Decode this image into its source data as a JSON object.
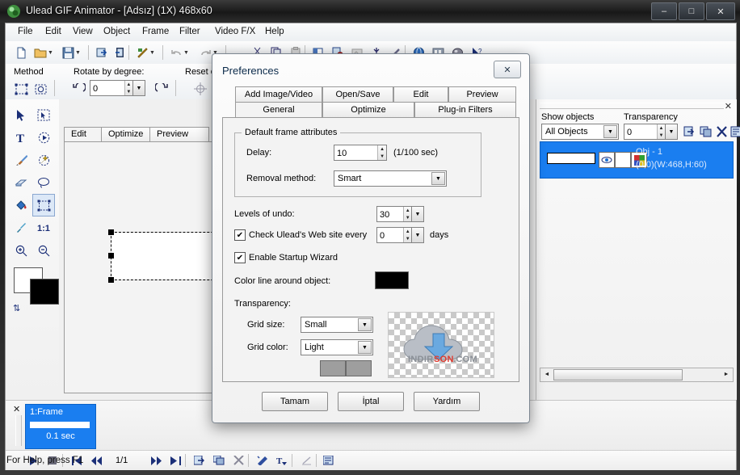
{
  "window": {
    "title": "Ulead GIF Animator - [Adsız] (1X) 468x60",
    "minimize": "–",
    "maximize": "□",
    "close": "✕",
    "app_icon": "app-icon"
  },
  "menubar": {
    "items": [
      "File",
      "Edit",
      "View",
      "Object",
      "Frame",
      "Filter",
      "Video F/X",
      "Help"
    ]
  },
  "toolbar_main": {
    "icons": [
      "new-file-icon",
      "open-folder-icon",
      "open-dropdown-caret",
      "save-icon",
      "save-dropdown-caret",
      "add-image-icon",
      "add-video-icon",
      "effects-icon",
      "effects-dropdown-caret",
      "undo-icon",
      "undo-dropdown-caret",
      "redo-icon",
      "redo-dropdown-caret",
      "cut-icon",
      "copy-icon",
      "paste-icon",
      "align-icon",
      "duplicate-icon",
      "optimize-icon",
      "wand-icon",
      "paint-icon",
      "browser-preview-icon",
      "filmstrip-icon",
      "object-icon",
      "help-arrow-icon"
    ]
  },
  "toolbar_attr": {
    "method_label": "Method",
    "method_icons": [
      "transform-method-icon",
      "rotate-method-icon"
    ],
    "rotate_label": "Rotate by degree:",
    "rotate_value": "0",
    "rotate_ccw_icon": "rotate-ccw-icon",
    "rotate_cw_icon": "rotate-cw-icon",
    "reset_label": "Reset c",
    "reset_icon": "reset-center-icon"
  },
  "toolbox": {
    "tools": [
      "pick-tool-icon",
      "select-object-tool-icon",
      "text-tool-icon",
      "animation-tool-icon",
      "paintbrush-tool-icon",
      "magic-wand-tool-icon",
      "eraser-tool-icon",
      "lasso-tool-icon",
      "paint-bucket-tool-icon",
      "transform-tool-icon",
      "eyedropper-tool-icon",
      "actual-size-tool-icon",
      "zoom-in-tool-icon",
      "zoom-out-tool-icon"
    ],
    "selected_tool": "transform-tool-icon",
    "foreground_color": "#ffffff",
    "background_color": "#000000",
    "swap_colors_icon": "swap-colors-icon"
  },
  "edit_panel": {
    "tabs": [
      "Edit",
      "Optimize",
      "Preview"
    ],
    "active_tab": "Edit"
  },
  "objects_panel": {
    "close_icon": "✕",
    "show_objects_label": "Show objects",
    "show_objects_value": "All Objects",
    "transparency_label": "Transparency",
    "transparency_value": "0",
    "buttons": [
      "add-object-icon",
      "duplicate-object-icon",
      "delete-object-icon",
      "object-properties-icon"
    ],
    "rows": [
      {
        "name": "Obj - 1",
        "dims": "(0,0)(W:468,H:60)",
        "eye_icon": "eye-visible-icon",
        "mask_icon": "mask-icon",
        "palette_icon": "palette-icon"
      }
    ],
    "scroll_left_icon": "◄",
    "scroll_right_icon": "►",
    "scroll_grip": "|||"
  },
  "frame_panel": {
    "close_icon": "✕",
    "frames": [
      {
        "title": "1:Frame",
        "duration": "0.1 sec"
      }
    ],
    "transport": {
      "play_icon": "play-icon",
      "stop_icon": "stop-icon",
      "first_icon": "first-frame-icon",
      "prev_icon": "previous-frame-icon",
      "counter": "1/1",
      "next_icon": "next-frame-icon",
      "last_icon": "last-frame-icon",
      "add_frame_icon": "add-frame-icon",
      "duplicate_frame_icon": "duplicate-frame-icon",
      "delete_frame_icon": "delete-frame-icon",
      "effect_icon": "frame-effect-icon",
      "text_banner_icon": "text-banner-icon",
      "tween_icon": "tween-icon",
      "frame_properties_icon": "frame-properties-icon"
    }
  },
  "statusbar": {
    "text": "For Help, press F1"
  },
  "dialog": {
    "title": "Preferences",
    "close_icon": "✕",
    "tabs_row1": [
      "Add Image/Video",
      "Open/Save",
      "Edit",
      "Preview"
    ],
    "tabs_row2": [
      "General",
      "Optimize",
      "Plug-in Filters"
    ],
    "active_tab": "General",
    "group_frame_attributes": {
      "caption": "Default frame attributes",
      "delay_label": "Delay:",
      "delay_value": "10",
      "delay_unit": "(1/100 sec)",
      "removal_label": "Removal method:",
      "removal_value": "Smart"
    },
    "undo_label": "Levels of undo:",
    "undo_value": "30",
    "check_web_label": "Check Ulead's Web site every",
    "check_web_checked": true,
    "check_web_value": "0",
    "check_web_unit": "days",
    "startup_wizard_label": "Enable Startup Wizard",
    "startup_wizard_checked": true,
    "color_line_label": "Color line around object:",
    "color_line_color": "#000000",
    "transparency_label": "Transparency:",
    "grid_size_label": "Grid size:",
    "grid_size_value": "Small",
    "grid_color_label": "Grid color:",
    "grid_color_value": "Light",
    "grid_swatch_1": "#9e9e9e",
    "grid_swatch_2": "#9e9e9e",
    "watermark": {
      "text_1": "INDIR",
      "text_2": "SON",
      "text_3": ".COM",
      "color_1": "#8a8f96",
      "color_2": "#e03a2f",
      "color_3": "#8a8f96"
    },
    "buttons": [
      "Tamam",
      "İptal",
      "Yardım"
    ]
  }
}
